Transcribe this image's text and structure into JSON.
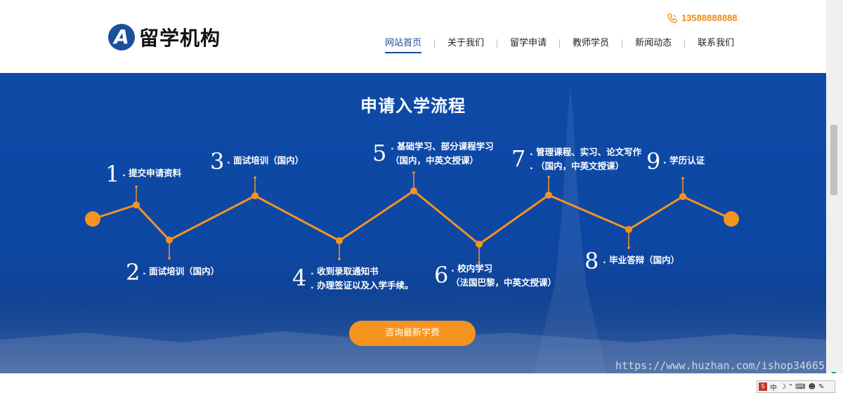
{
  "header": {
    "logo_letter": "A",
    "logo_text": "留学机构",
    "phone": "13588888888",
    "nav": [
      {
        "label": "网站首页",
        "active": true
      },
      {
        "label": "关于我们",
        "active": false
      },
      {
        "label": "留学申请",
        "active": false
      },
      {
        "label": "教师学员",
        "active": false
      },
      {
        "label": "新闻动态",
        "active": false
      },
      {
        "label": "联系我们",
        "active": false
      }
    ]
  },
  "process": {
    "title": "申请入学流程",
    "steps": [
      {
        "num": "1",
        "lines": [
          ". 提交申请资料"
        ]
      },
      {
        "num": "2",
        "lines": [
          ". 面试培训（国内）"
        ]
      },
      {
        "num": "3",
        "lines": [
          ". 面试培训（国内）"
        ]
      },
      {
        "num": "4",
        "lines": [
          ". 收到录取通知书",
          ". 办理签证以及入学手续。"
        ]
      },
      {
        "num": "5",
        "lines": [
          ". 基础学习、部分课程学习",
          "（国内，中英文授课）"
        ]
      },
      {
        "num": "6",
        "lines": [
          ". 校内学习",
          "（法国巴黎，中英文授课）"
        ]
      },
      {
        "num": "7",
        "lines": [
          ". 管理课程、实习、论文写作",
          ". （国内，中英文授课）"
        ]
      },
      {
        "num": "8",
        "lines": [
          ". 毕业答辩（国内）"
        ]
      },
      {
        "num": "9",
        "lines": [
          ". 学历认证"
        ]
      }
    ],
    "cta": "咨询最新学费"
  },
  "colors": {
    "brand_blue": "#1a4c9b",
    "orange": "#f5931f",
    "banner_blue": "#0f4aa7"
  },
  "watermark": "https://www.huzhan.com/ishop34665",
  "ime": {
    "lang": "中",
    "icons": [
      "moon-icon",
      "quote-icon",
      "keyboard-icon",
      "user-icon",
      "wrench-icon"
    ]
  }
}
